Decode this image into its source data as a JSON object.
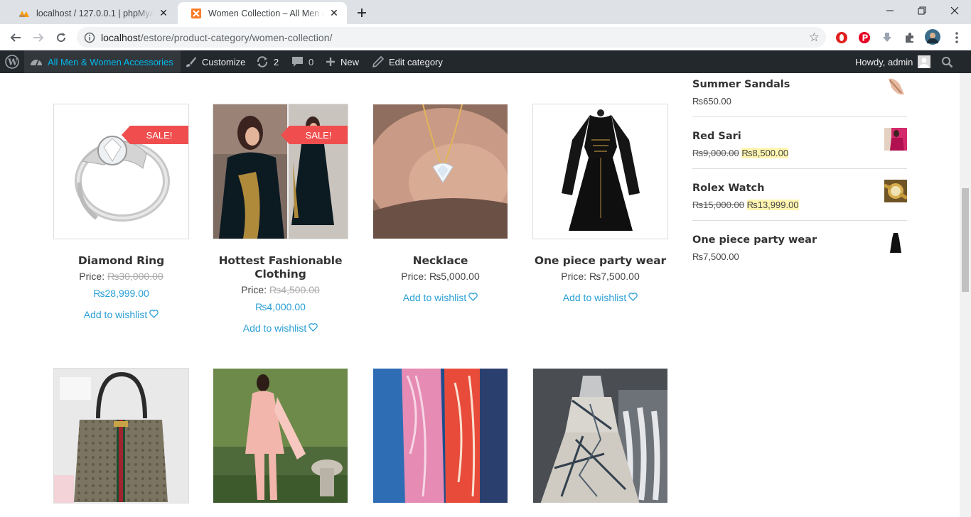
{
  "browser": {
    "tabs": [
      {
        "title": "localhost / 127.0.0.1 | phpMyAdmin",
        "active": false
      },
      {
        "title": "Women Collection – All Men & Women Accessories",
        "active": true
      }
    ],
    "url_host": "localhost",
    "url_path": "/estore/product-category/women-collection/"
  },
  "adminbar": {
    "site_name": "All Men & Women Accessories",
    "customize": "Customize",
    "updates_count": "2",
    "comments_count": "0",
    "new_label": "New",
    "edit_label": "Edit category",
    "howdy": "Howdy, admin"
  },
  "products": [
    {
      "name": "Diamond Ring",
      "price_label": "Price:",
      "old_price": "₨30,000.00",
      "sale_price": "₨28,999.00",
      "on_sale": true,
      "badge": "SALE!",
      "wishlist": "Add to wishlist"
    },
    {
      "name": "Hottest Fashionable Clothing",
      "price_label": "Price:",
      "old_price": "₨4,500.00",
      "sale_price": "₨4,000.00",
      "on_sale": true,
      "badge": "SALE!",
      "wishlist": "Add to wishlist"
    },
    {
      "name": "Necklace",
      "price_label": "Price:",
      "price": "₨5,000.00",
      "wishlist": "Add to wishlist"
    },
    {
      "name": "One piece party wear",
      "price_label": "Price:",
      "price": "₨7,500.00",
      "wishlist": "Add to wishlist"
    }
  ],
  "sidebar": {
    "items": [
      {
        "name": "Summer Sandals",
        "price": "₨650.00"
      },
      {
        "name": "Red Sari",
        "old_price": "₨9,000.00",
        "new_price": "₨8,500.00"
      },
      {
        "name": "Rolex Watch",
        "old_price": "₨15,000.00",
        "new_price": "₨13,999.00"
      },
      {
        "name": "One piece party wear",
        "price": "₨7,500.00"
      }
    ]
  },
  "colors": {
    "link": "#2a9fd6",
    "sale_badge": "#f04e4e",
    "adminbar": "#23282d",
    "site_link": "#00b9eb"
  }
}
